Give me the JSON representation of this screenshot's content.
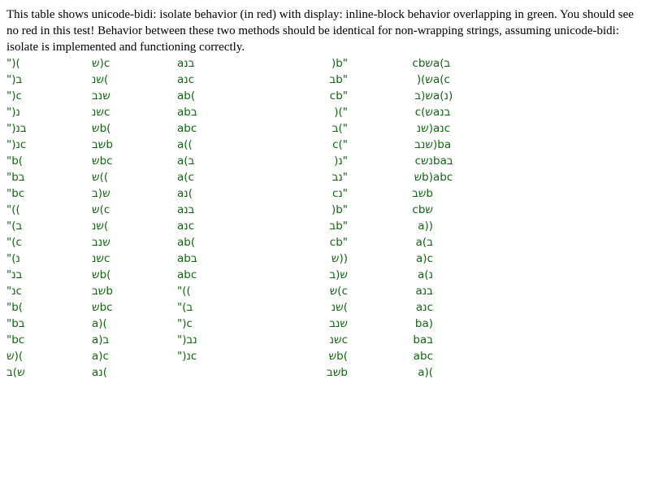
{
  "intro_text": "This table shows unicode-bidi: isolate behavior (in red) with display: inline-block behavior overlapping in green. You should see no red in this test! Behavior between these two methods should be identical for non-wrapping strings, assuming unicode-bidi: isolate is implemented and functioning correctly.",
  "columns": [
    {
      "align": "left",
      "cells": [
        "\")(",
        "\")ב",
        "\")c",
        "\")נ",
        "\")בנ",
        "\")נc",
        "\"b(",
        "\"bב",
        "\"bc",
        "\"((",
        "\"(ב",
        "\"(c",
        "\"(נ",
        "\"בנ",
        "\"נc",
        "\"b(",
        "\"bב",
        "\"bc",
        "ש)(",
        "ש)ב"
      ]
    },
    {
      "align": "left",
      "cells": [
        "ש)c",
        "שנ(",
        "שנב",
        "שנc",
        "שb(",
        "שבb",
        "שbc",
        "ש((",
        "ש(ב",
        "ש(c",
        "שנ(",
        "שנב",
        "שנc",
        "שb(",
        "שבb",
        "שbc",
        "a)(",
        "a)ב",
        "a)c",
        "aנ("
      ]
    },
    {
      "align": "left",
      "cells": [
        "aבנ",
        "aנc",
        "ab(",
        "abב",
        "abc",
        "a((",
        "a(ב",
        "a(c",
        "aנ(",
        "aבנ",
        "aנc",
        "ab(",
        "abב",
        "abc",
        "\"((",
        "\"(ב",
        "\")c",
        "\")נב",
        "\")נc",
        ""
      ]
    },
    {
      "align": "right",
      "cells": [
        ")b\"",
        "בb\"",
        "cb\"",
        ")(\"",
        "ב(\"",
        "c(\"",
        ")נ\"",
        "נב\"",
        "cנ\"",
        ")b\"",
        "בb\"",
        "cb\"",
        "ש))",
        "ש(ב",
        "ש(c",
        "שנ(",
        "שנב",
        "שנc",
        "שb(",
        "שבb"
      ]
    },
    {
      "align": "right",
      "cells": [
        "cbש",
        ")(ש",
        "ש(ב",
        "c(ש",
        "שנ)",
        "שנב",
        "cנש",
        "שb)",
        "שבb",
        "cbש",
        "a))",
        "a(ב",
        "a)c",
        "a(נ",
        "aבנ",
        "aנc",
        "ba)",
        "baב",
        "abc",
        "a)("
      ]
    },
    {
      "align": "left",
      "cells": [
        "a(ב",
        "a(c",
        "a(נ)",
        "aבנ",
        "aנc",
        ")ba",
        "baב",
        "abc"
      ]
    }
  ]
}
